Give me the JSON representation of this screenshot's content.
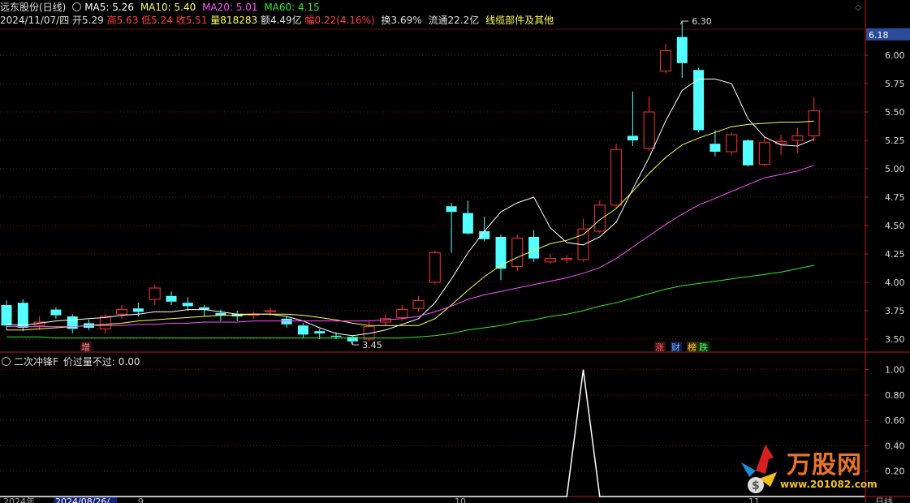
{
  "header": {
    "stock_name": "远东股份(日线)",
    "ma5_label": "MA5: 5.26",
    "ma10_label": "MA10: 5.40",
    "ma20_label": "MA20: 5.01",
    "ma60_label": "MA60: 4.15",
    "date": "2024/11/07/四",
    "open": "开5.29",
    "high": "高5.63",
    "low": "低5.24",
    "close": "收5.51",
    "volume": "量818283",
    "amount": "额4.49亿",
    "change": "幅0.22(4.16%)",
    "turnover": "换3.69%",
    "float": "流通22.2亿",
    "sector": "线缆部件及其他"
  },
  "indicator": {
    "title": "二次冲锋F",
    "label": "价过量不过: 0.00"
  },
  "markers": {
    "add": "增",
    "zhang": "涨",
    "cai": "财",
    "bang": "榜",
    "die": "跌"
  },
  "bottom": {
    "year": "2024年",
    "date": "2024/08/26/",
    "m9": "9",
    "m10": "10",
    "m11": "11",
    "period": "日线"
  },
  "watermark": {
    "title": "万股网",
    "url": "www.201082.com"
  },
  "colors": {
    "up": "#ff3232",
    "down": "#54ffff",
    "ma5": "#ffffff",
    "ma10": "#ffff50",
    "ma20": "#ff50ff",
    "ma60": "#32e832",
    "grid": "#8a1010"
  },
  "chart_data": [
    {
      "type": "candlestick",
      "title": "远东股份(日线)",
      "ylim": [
        3.4,
        6.2
      ],
      "y_ticks": [
        3.5,
        3.75,
        4.0,
        4.25,
        4.5,
        4.75,
        5.0,
        5.25,
        5.5,
        5.75,
        6.0
      ],
      "current_price_tag": "6.18",
      "max_label": "6.30",
      "min_label": "3.45",
      "candles": [
        [
          3.8,
          3.62,
          3.84,
          3.58
        ],
        [
          3.82,
          3.6,
          3.85,
          3.57
        ],
        [
          3.62,
          3.65,
          3.7,
          3.58
        ],
        [
          3.76,
          3.71,
          3.78,
          3.68
        ],
        [
          3.7,
          3.59,
          3.72,
          3.55
        ],
        [
          3.64,
          3.6,
          3.67,
          3.58
        ],
        [
          3.59,
          3.7,
          3.72,
          3.55
        ],
        [
          3.72,
          3.76,
          3.8,
          3.68
        ],
        [
          3.77,
          3.74,
          3.82,
          3.7
        ],
        [
          3.85,
          3.95,
          3.98,
          3.8
        ],
        [
          3.88,
          3.83,
          3.92,
          3.8
        ],
        [
          3.82,
          3.79,
          3.87,
          3.75
        ],
        [
          3.78,
          3.76,
          3.8,
          3.7
        ],
        [
          3.73,
          3.71,
          3.76,
          3.66
        ],
        [
          3.72,
          3.7,
          3.75,
          3.66
        ],
        [
          3.71,
          3.72,
          3.74,
          3.68
        ],
        [
          3.74,
          3.75,
          3.78,
          3.7
        ],
        [
          3.68,
          3.63,
          3.7,
          3.6
        ],
        [
          3.62,
          3.54,
          3.64,
          3.51
        ],
        [
          3.57,
          3.55,
          3.59,
          3.5
        ],
        [
          3.53,
          3.52,
          3.56,
          3.5
        ],
        [
          3.52,
          3.48,
          3.53,
          3.45
        ],
        [
          3.5,
          3.61,
          3.66,
          3.48
        ],
        [
          3.65,
          3.68,
          3.72,
          3.62
        ],
        [
          3.69,
          3.76,
          3.8,
          3.66
        ],
        [
          3.77,
          3.84,
          3.88,
          3.74
        ],
        [
          4.0,
          4.26,
          4.28,
          3.98
        ],
        [
          4.67,
          4.62,
          4.7,
          4.26
        ],
        [
          4.61,
          4.43,
          4.72,
          4.42
        ],
        [
          4.45,
          4.38,
          4.58,
          4.36
        ],
        [
          4.4,
          4.12,
          4.42,
          4.02
        ],
        [
          4.14,
          4.39,
          4.42,
          4.1
        ],
        [
          4.4,
          4.21,
          4.46,
          4.18
        ],
        [
          4.18,
          4.21,
          4.25,
          4.16
        ],
        [
          4.2,
          4.21,
          4.24,
          4.17
        ],
        [
          4.2,
          4.47,
          4.56,
          4.18
        ],
        [
          4.45,
          4.68,
          4.72,
          4.43
        ],
        [
          4.68,
          5.17,
          5.22,
          4.66
        ],
        [
          5.29,
          5.25,
          5.68,
          5.2
        ],
        [
          5.18,
          5.5,
          5.64,
          5.16
        ],
        [
          5.86,
          6.04,
          6.1,
          5.84
        ],
        [
          6.16,
          5.93,
          6.3,
          5.8
        ],
        [
          5.87,
          5.34,
          5.89,
          5.32
        ],
        [
          5.22,
          5.15,
          5.34,
          5.11
        ],
        [
          5.15,
          5.3,
          5.32,
          5.12
        ],
        [
          5.25,
          5.03,
          5.26,
          5.02
        ],
        [
          5.04,
          5.23,
          5.28,
          5.02
        ],
        [
          5.22,
          5.24,
          5.3,
          5.12
        ],
        [
          5.25,
          5.29,
          5.36,
          5.14
        ],
        [
          5.29,
          5.51,
          5.63,
          5.24
        ]
      ],
      "ma5": [
        3.63,
        3.62,
        3.64,
        3.66,
        3.67,
        3.68,
        3.69,
        3.71,
        3.72,
        3.74,
        3.74,
        3.76,
        3.76,
        3.74,
        3.72,
        3.72,
        3.72,
        3.7,
        3.66,
        3.6,
        3.55,
        3.53,
        3.55,
        3.58,
        3.63,
        3.68,
        3.82,
        4.03,
        4.26,
        4.45,
        4.62,
        4.7,
        4.75,
        4.48,
        4.35,
        4.33,
        4.4,
        4.53,
        4.82,
        5.1,
        5.42,
        5.69,
        5.79,
        5.79,
        5.75,
        5.44,
        5.28,
        5.21,
        5.2,
        5.26
      ],
      "ma10": [
        3.58,
        3.58,
        3.59,
        3.6,
        3.61,
        3.62,
        3.63,
        3.64,
        3.66,
        3.67,
        3.68,
        3.69,
        3.7,
        3.71,
        3.71,
        3.72,
        3.72,
        3.72,
        3.71,
        3.69,
        3.67,
        3.64,
        3.62,
        3.62,
        3.62,
        3.62,
        3.68,
        3.8,
        3.93,
        4.05,
        4.15,
        4.22,
        4.28,
        4.34,
        4.37,
        4.42,
        4.55,
        4.65,
        4.8,
        4.96,
        5.1,
        5.21,
        5.27,
        5.32,
        5.37,
        5.39,
        5.4,
        5.41,
        5.41,
        5.42
      ],
      "ma20": [
        3.61,
        3.61,
        3.61,
        3.61,
        3.61,
        3.62,
        3.62,
        3.62,
        3.63,
        3.63,
        3.64,
        3.64,
        3.65,
        3.65,
        3.65,
        3.66,
        3.66,
        3.66,
        3.66,
        3.66,
        3.66,
        3.66,
        3.66,
        3.67,
        3.68,
        3.7,
        3.74,
        3.79,
        3.85,
        3.89,
        3.92,
        3.95,
        3.98,
        4.01,
        4.04,
        4.08,
        4.13,
        4.21,
        4.31,
        4.41,
        4.51,
        4.6,
        4.68,
        4.74,
        4.8,
        4.86,
        4.92,
        4.95,
        4.98,
        5.03
      ],
      "ma60": [
        3.52,
        3.52,
        3.52,
        3.51,
        3.51,
        3.51,
        3.51,
        3.51,
        3.51,
        3.51,
        3.51,
        3.51,
        3.51,
        3.51,
        3.51,
        3.51,
        3.51,
        3.51,
        3.51,
        3.51,
        3.51,
        3.51,
        3.51,
        3.51,
        3.51,
        3.52,
        3.53,
        3.55,
        3.58,
        3.6,
        3.62,
        3.65,
        3.67,
        3.7,
        3.72,
        3.75,
        3.79,
        3.82,
        3.86,
        3.9,
        3.94,
        3.97,
        3.99,
        4.01,
        4.03,
        4.05,
        4.07,
        4.09,
        4.12,
        4.15
      ]
    },
    {
      "type": "line",
      "title": "二次冲锋F",
      "ylim": [
        0,
        1.1
      ],
      "y_ticks": [
        0.2,
        0.4,
        0.6,
        0.8,
        1.0
      ],
      "series": [
        {
          "name": "价过量不过",
          "values": [
            0,
            0,
            0,
            0,
            0,
            0,
            0,
            0,
            0,
            0,
            0,
            0,
            0,
            0,
            0,
            0,
            0,
            0,
            0,
            0,
            0,
            0,
            0,
            0,
            0,
            0,
            0,
            0,
            0,
            0,
            0,
            0,
            0,
            0,
            0,
            1,
            0,
            0,
            0,
            0,
            0,
            0,
            0,
            0,
            0,
            0,
            0,
            0,
            0,
            0
          ]
        }
      ]
    }
  ]
}
